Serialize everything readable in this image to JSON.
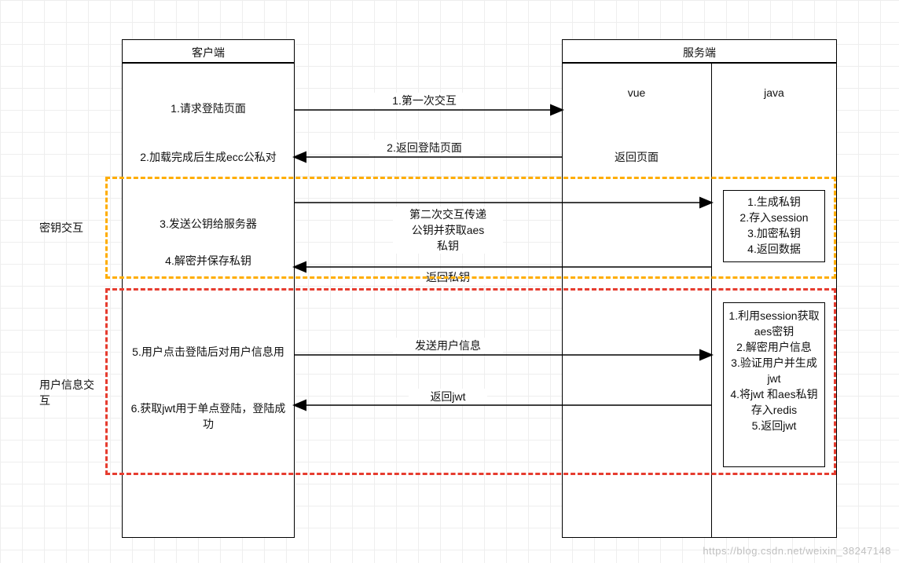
{
  "columns": {
    "client_header": "客户端",
    "server_header": "服务端",
    "vue_label": "vue",
    "java_label": "java"
  },
  "client_steps": {
    "s1": "1.请求登陆页面",
    "s2": "2.加载完成后生成ecc公私对",
    "s3": "3.发送公钥给服务器",
    "s4": "4.解密并保存私钥",
    "s5": "5.用户点击登陆后对用户信息用",
    "s6": "6.获取jwt用于单点登陆，登陆成功"
  },
  "server": {
    "vue_text": "返回页面",
    "java_block1": {
      "l1": "1.生成私钥",
      "l2": "2.存入session",
      "l3": "3.加密私钥",
      "l4": "4.返回数据"
    },
    "java_block2": {
      "l1": "1.利用session获取aes密钥",
      "l2": "2.解密用户信息",
      "l3": "3.验证用户并生成jwt",
      "l4": "4.将jwt 和aes私钥存入redis",
      "l5": "5.返回jwt"
    }
  },
  "arrows": {
    "a1": "1.第一次交互",
    "a2": "2.返回登陆页面",
    "a3_l1": "第二次交互传递",
    "a3_l2": "公钥并获取aes",
    "a3_l3": "私钥",
    "a4": "返回私钥",
    "a5": "发送用户信息",
    "a6": "返回jwt"
  },
  "groups": {
    "key_ex": "密钥交互",
    "user_info_l1": "用户信息交",
    "user_info_l2": "互"
  },
  "watermark": "https://blog.csdn.net/weixin_38247148"
}
